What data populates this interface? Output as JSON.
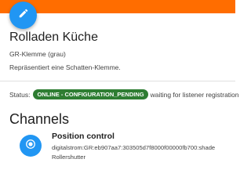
{
  "colors": {
    "accent_bar": "#ff6d00",
    "primary": "#2196f3",
    "status_online": "#2e7d32"
  },
  "header": {
    "edit_icon": "pencil-icon"
  },
  "thing": {
    "title": "Rolladen Küche",
    "subtitle": "GR-Klemme (grau)",
    "description": "Repräsentiert eine Schatten-Klemme."
  },
  "status": {
    "label": "Status:",
    "badge": "ONLINE - CONFIGURATION_PENDING",
    "detail": "waiting for listener registration"
  },
  "channels": {
    "heading": "Channels",
    "items": [
      {
        "icon": "target-icon",
        "title": "Position control",
        "uid": "digitalstrom:GR:eb907aa7:303505d7f8000f00000fb700:shade",
        "type": "Rollershutter"
      }
    ]
  }
}
